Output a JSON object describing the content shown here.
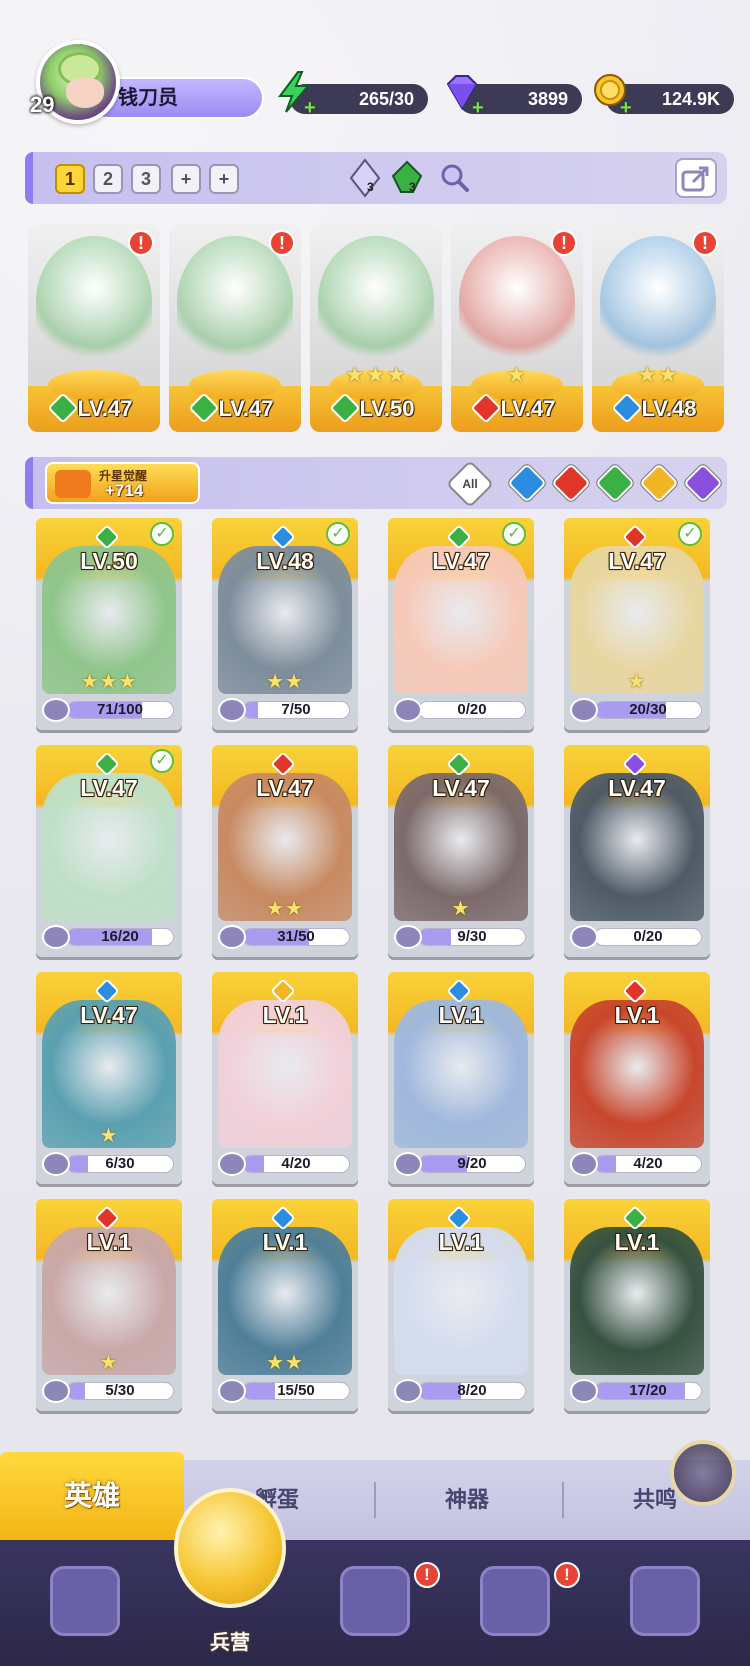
{
  "player": {
    "level": "29",
    "name": "钱刀员"
  },
  "resources": [
    {
      "key": "energy",
      "icon": "lightning-icon",
      "value": "265/30",
      "color": "#3ad25a"
    },
    {
      "key": "gems",
      "icon": "gem-icon",
      "value": "3899",
      "color": "#8a5cf5"
    },
    {
      "key": "gold",
      "icon": "coin-icon",
      "value": "124.9K",
      "color": "#f3c01a"
    }
  ],
  "team": {
    "slots": [
      "1",
      "2",
      "3",
      "+",
      "+"
    ],
    "active_slot": "1",
    "items": [
      {
        "icon": "crystal-icon",
        "count": "3"
      },
      {
        "icon": "green-gem-icon",
        "count": "3"
      }
    ]
  },
  "lineup": [
    {
      "element": "wind",
      "level": "LV.47",
      "stars": "",
      "alert": "!"
    },
    {
      "element": "wind",
      "level": "LV.47",
      "stars": "",
      "alert": "!"
    },
    {
      "element": "wind",
      "level": "LV.50",
      "stars": "★★★",
      "alert": ""
    },
    {
      "element": "fire",
      "level": "LV.47",
      "stars": "★",
      "alert": "!"
    },
    {
      "element": "water",
      "level": "LV.48",
      "stars": "★★",
      "alert": "!"
    }
  ],
  "filter": {
    "awaken_label": "升星觉醒",
    "awaken_value": "+714",
    "all_label": "All",
    "elements": [
      "water",
      "fire",
      "wind",
      "light",
      "dark"
    ]
  },
  "element_colors": {
    "wind": "#3bb045",
    "fire": "#e2352a",
    "water": "#2b8de0",
    "light": "#f2b625",
    "dark": "#8b4fe0"
  },
  "heroes": [
    {
      "level": "LV.50",
      "element": "wind",
      "stars": "★★★",
      "shards": "71/100",
      "fill": 0.71,
      "checked": true,
      "art": "#8fc58a"
    },
    {
      "level": "LV.48",
      "element": "water",
      "stars": "★★",
      "shards": "7/50",
      "fill": 0.14,
      "checked": true,
      "art": "#7d8d9b"
    },
    {
      "level": "LV.47",
      "element": "wind",
      "stars": "",
      "shards": "0/20",
      "fill": 0.0,
      "checked": true,
      "art": "#f6c9b8"
    },
    {
      "level": "LV.47",
      "element": "fire",
      "stars": "★",
      "shards": "20/30",
      "fill": 0.67,
      "checked": true,
      "art": "#e8d6a0"
    },
    {
      "level": "LV.47",
      "element": "wind",
      "stars": "",
      "shards": "16/20",
      "fill": 0.8,
      "checked": true,
      "art": "#bfe0c7"
    },
    {
      "level": "LV.47",
      "element": "fire",
      "stars": "★★",
      "shards": "31/50",
      "fill": 0.62,
      "checked": false,
      "art": "#c88a62"
    },
    {
      "level": "LV.47",
      "element": "wind",
      "stars": "★",
      "shards": "9/30",
      "fill": 0.3,
      "checked": false,
      "art": "#7c6a6a"
    },
    {
      "level": "LV.47",
      "element": "dark",
      "stars": "",
      "shards": "0/20",
      "fill": 0.0,
      "checked": false,
      "art": "#4e5a66"
    },
    {
      "level": "LV.47",
      "element": "water",
      "stars": "★",
      "shards": "6/30",
      "fill": 0.2,
      "checked": false,
      "art": "#5aa0b0"
    },
    {
      "level": "LV.1",
      "element": "light",
      "stars": "",
      "shards": "4/20",
      "fill": 0.2,
      "checked": false,
      "art": "#f1d0d9"
    },
    {
      "level": "LV.1",
      "element": "water",
      "stars": "",
      "shards": "9/20",
      "fill": 0.45,
      "checked": false,
      "art": "#9fb8dc"
    },
    {
      "level": "LV.1",
      "element": "fire",
      "stars": "",
      "shards": "4/20",
      "fill": 0.2,
      "checked": false,
      "art": "#c8462c"
    },
    {
      "level": "LV.1",
      "element": "fire",
      "stars": "★",
      "shards": "5/30",
      "fill": 0.17,
      "checked": false,
      "art": "#c9a7a7"
    },
    {
      "level": "LV.1",
      "element": "water",
      "stars": "★★",
      "shards": "15/50",
      "fill": 0.3,
      "checked": false,
      "art": "#4f7f98"
    },
    {
      "level": "LV.1",
      "element": "water",
      "stars": "",
      "shards": "8/20",
      "fill": 0.4,
      "checked": false,
      "art": "#d4dcef"
    },
    {
      "level": "LV.1",
      "element": "wind",
      "stars": "",
      "shards": "17/20",
      "fill": 0.85,
      "checked": false,
      "art": "#365240"
    }
  ],
  "subtabs": [
    {
      "label": "英雄",
      "active": true
    },
    {
      "label": "孵蛋",
      "active": false
    },
    {
      "label": "神器",
      "active": false
    },
    {
      "label": "共鸣",
      "active": false
    }
  ],
  "nav": {
    "items": [
      {
        "icon": "cards-icon",
        "alert": ""
      },
      {
        "icon": "map-icon",
        "alert": "!"
      },
      {
        "icon": "castle-icon",
        "alert": "!"
      },
      {
        "icon": "mushroom-icon",
        "alert": ""
      }
    ],
    "active_label": "兵营",
    "active_icon": "helmet-icon"
  }
}
